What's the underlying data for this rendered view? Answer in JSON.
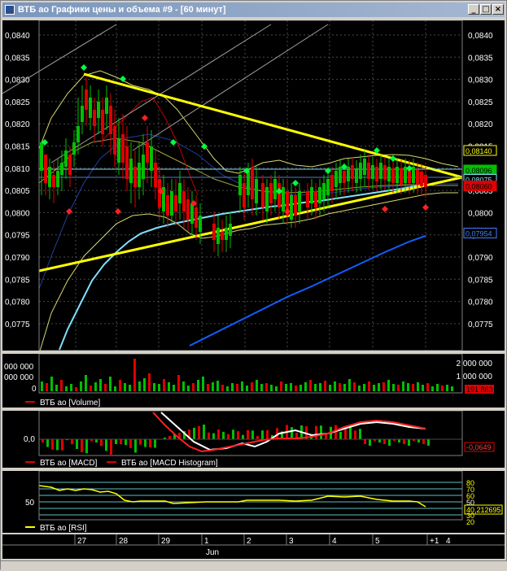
{
  "window": {
    "title": "ВТБ ао Графики цены и объема #9 - [60 минут]",
    "min_glyph": "_",
    "max_glyph": "□",
    "close_glyph": "×"
  },
  "colors": {
    "background": "#000000",
    "grid": "#4a4a4a",
    "axis_text": "#ffffff",
    "candle_up": "#00c000",
    "candle_down": "#e00000",
    "trendline": "#ffff00",
    "ma_fast": "#80e0ff",
    "ma_slow": "#1060ff",
    "bollinger": "#d8d870",
    "marker_up": "#00ff40",
    "marker_down": "#ff2020"
  },
  "price_panel": {
    "ticks": [
      "0,0840",
      "0,0835",
      "0,0830",
      "0,0825",
      "0,0820",
      "0,0815",
      "0,0810",
      "0,0805",
      "0,0800",
      "0,0795",
      "0,0790",
      "0,0785",
      "0,0780",
      "0,0775"
    ],
    "badges": [
      {
        "text": "0,08140",
        "bg": "#000000",
        "fg": "#ffff00",
        "border": "#ffff00",
        "value": 0.0814
      },
      {
        "text": "0,08096",
        "bg": "#00c000",
        "fg": "#000000",
        "border": "#00c000",
        "value": 0.08096
      },
      {
        "text": "0,08075",
        "bg": "#000000",
        "fg": "#80e0ff",
        "border": "#80e0ff",
        "value": 0.08075
      },
      {
        "text": "0,08060",
        "bg": "#e00000",
        "fg": "#000000",
        "border": "#e00000",
        "value": 0.0806
      },
      {
        "text": "0,07954",
        "bg": "#000000",
        "fg": "#4080ff",
        "border": "#4080ff",
        "value": 0.07954
      }
    ]
  },
  "volume_panel": {
    "ticks": [
      "2 000 000",
      "1 000 000",
      "0"
    ],
    "left_ticks": [
      "000 000",
      "000 000",
      "0"
    ],
    "legend": "ВТБ ао [Volume]",
    "badge": "191 863"
  },
  "macd_panel": {
    "tick": "0,0",
    "left_tick": "0,0",
    "legend1": "ВТБ ао [MACD]",
    "legend2": "ВТБ ао [MACD Histogram]",
    "badge": "-0,0649"
  },
  "rsi_panel": {
    "ticks": [
      "80",
      "70",
      "60",
      "50",
      "30",
      "20"
    ],
    "left_tick": "50",
    "legend": "ВТБ ао [RSI]",
    "badge": "40,212695"
  },
  "time_axis": {
    "days": [
      "27",
      "28",
      "29",
      "1",
      "2",
      "3",
      "4",
      "5",
      "+1"
    ],
    "month": "Jun",
    "extra": "4"
  }
}
